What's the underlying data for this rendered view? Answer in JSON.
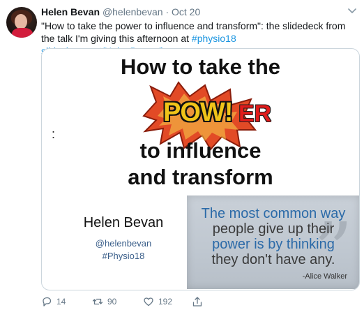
{
  "author": {
    "name": "Helen Bevan",
    "handle": "@helenbevan",
    "separator": "·",
    "date": "Oct 20"
  },
  "tweet": {
    "text_1": "\"How to take the power to influence and transform\": the slidedeck from the talk I'm giving this afternoon at ",
    "hashtag": "#physio18",
    "space": " ",
    "link": "slideshare.net/HelenBevan/how..."
  },
  "slide": {
    "line1": "How to take the",
    "pow": "POW!",
    "er": "ER",
    "colon": ":",
    "line3": "to influence",
    "line4": "and transform",
    "author_name": "Helen Bevan",
    "author_handle": "@helenbevan",
    "author_tag": "#Physio18"
  },
  "quote": {
    "w1": "The most common way",
    "w2": "people give up their",
    "w3": "power is by thinking",
    "w4": "they don't have any.",
    "attribution": "-Alice Walker"
  },
  "actions": {
    "reply_count": "14",
    "retweet_count": "90",
    "like_count": "192"
  },
  "icons": [
    "chevron-down-icon",
    "reply-icon",
    "retweet-icon",
    "like-icon",
    "share-icon"
  ],
  "colors": {
    "link": "#1b95e0",
    "muted": "#657786",
    "pow": "#f0c419",
    "er": "#e11b1b"
  }
}
